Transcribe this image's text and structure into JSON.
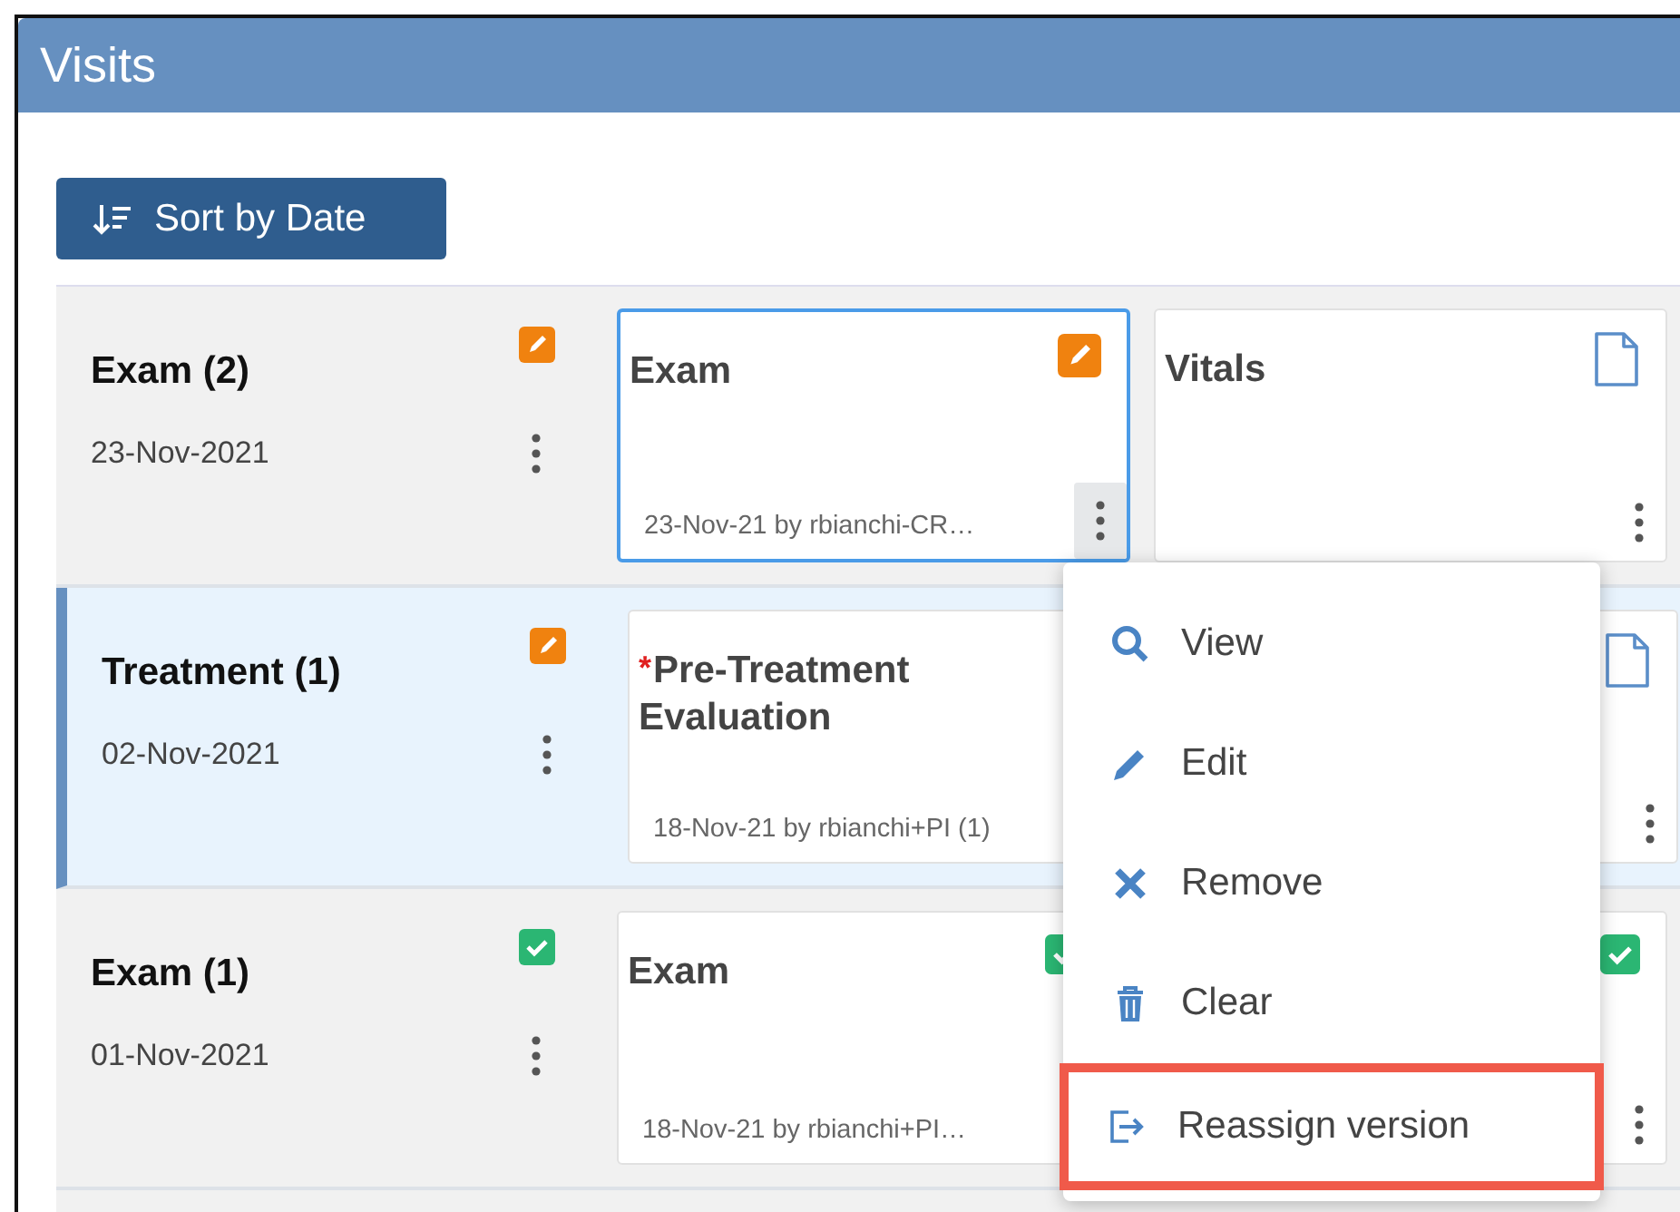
{
  "panel": {
    "title": "Visits"
  },
  "sort_button": {
    "label": "Sort by Date"
  },
  "visits": [
    {
      "title": "Exam (2)",
      "date": "23-Nov-2021",
      "kind": "editing",
      "selected": false,
      "cards": [
        {
          "title": "Exam",
          "kind": "editing",
          "footer": "23-Nov-21 by rbianchi-CR…",
          "selected": true
        },
        {
          "title": "Vitals",
          "kind": "blank",
          "selected": false
        }
      ]
    },
    {
      "title": "Treatment (1)",
      "date": "02-Nov-2021",
      "kind": "editing",
      "selected": true,
      "cards": [
        {
          "required_mark": "*",
          "title": "Pre-Treatment Evaluation",
          "footer": "18-Nov-21 by rbianchi+PI (1)",
          "selected": false
        },
        {
          "kind": "blank",
          "selected": false
        }
      ]
    },
    {
      "title": "Exam (1)",
      "date": "01-Nov-2021",
      "kind": "done",
      "selected": false,
      "cards": [
        {
          "title": "Exam",
          "kind": "done",
          "footer": "18-Nov-21 by rbianchi+PI…",
          "selected": false
        },
        {
          "kind": "done",
          "selected": false
        }
      ]
    }
  ],
  "context_menu": {
    "items": [
      {
        "label": "View",
        "highlighted": false
      },
      {
        "label": "Edit",
        "highlighted": false
      },
      {
        "label": "Remove",
        "highlighted": false
      },
      {
        "label": "Clear",
        "highlighted": false
      },
      {
        "label": "Reassign version",
        "highlighted": true
      }
    ]
  }
}
